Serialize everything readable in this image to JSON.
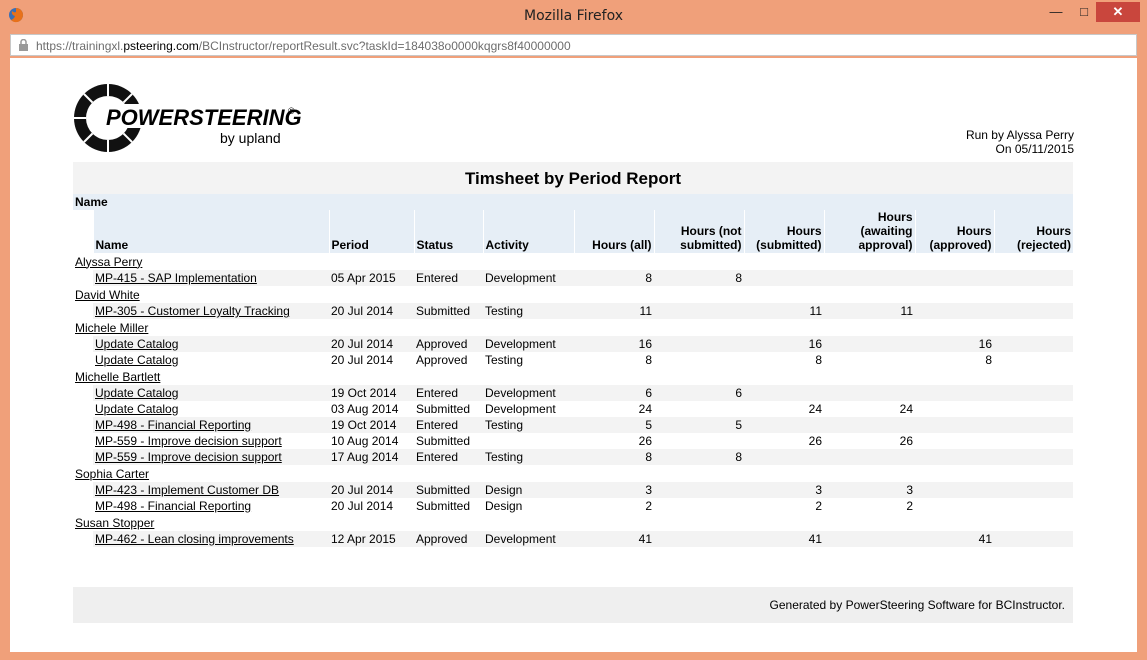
{
  "browser": {
    "window_title": "Mozilla Firefox",
    "url_prefix": "https://trainingxl.",
    "url_host": "psteering.com",
    "url_path": "/BCInstructor/reportResult.svc?taskId=184038o0000kqgrs8f40000000",
    "minimize": "—",
    "maximize": "□",
    "close": "✕"
  },
  "logo": {
    "brand": "POWERSTEERING",
    "sub": "by upland",
    "reg": "®"
  },
  "run_info": {
    "run_by": "Run by Alyssa Perry",
    "on_date": "On 05/11/2015"
  },
  "report_title": "Timsheet by Period Report",
  "group_header": "Name",
  "columns": [
    "Name",
    "Period",
    "Status",
    "Activity",
    "Hours (all)",
    "Hours (not submitted)",
    "Hours (submitted)",
    "Hours (awaiting approval)",
    "Hours (approved)",
    "Hours (rejected)"
  ],
  "rows": [
    {
      "person": "Alyssa Perry"
    },
    {
      "name": "MP-415 - SAP Implementation",
      "period": "05 Apr 2015",
      "status": "Entered",
      "activity": "Development",
      "all": "8",
      "not_sub": "8",
      "sub": "",
      "await": "",
      "appr": "",
      "rej": ""
    },
    {
      "person": "David White"
    },
    {
      "name": "MP-305 - Customer Loyalty Tracking",
      "period": "20 Jul 2014",
      "status": "Submitted",
      "activity": "Testing",
      "all": "11",
      "not_sub": "",
      "sub": "11",
      "await": "11",
      "appr": "",
      "rej": ""
    },
    {
      "person": "Michele Miller"
    },
    {
      "name": "Update Catalog",
      "period": "20 Jul 2014",
      "status": "Approved",
      "activity": "Development",
      "all": "16",
      "not_sub": "",
      "sub": "16",
      "await": "",
      "appr": "16",
      "rej": ""
    },
    {
      "name": "Update Catalog",
      "period": "20 Jul 2014",
      "status": "Approved",
      "activity": "Testing",
      "all": "8",
      "not_sub": "",
      "sub": "8",
      "await": "",
      "appr": "8",
      "rej": ""
    },
    {
      "person": "Michelle Bartlett"
    },
    {
      "name": "Update Catalog",
      "period": "19 Oct 2014",
      "status": "Entered",
      "activity": "Development",
      "all": "6",
      "not_sub": "6",
      "sub": "",
      "await": "",
      "appr": "",
      "rej": ""
    },
    {
      "name": "Update Catalog",
      "period": "03 Aug 2014",
      "status": "Submitted",
      "activity": "Development",
      "all": "24",
      "not_sub": "",
      "sub": "24",
      "await": "24",
      "appr": "",
      "rej": ""
    },
    {
      "name": "MP-498 - Financial Reporting",
      "period": "19 Oct 2014",
      "status": "Entered",
      "activity": "Testing",
      "all": "5",
      "not_sub": "5",
      "sub": "",
      "await": "",
      "appr": "",
      "rej": ""
    },
    {
      "name": "MP-559 - Improve decision support",
      "period": "10 Aug 2014",
      "status": "Submitted",
      "activity": "",
      "all": "26",
      "not_sub": "",
      "sub": "26",
      "await": "26",
      "appr": "",
      "rej": ""
    },
    {
      "name": "MP-559 - Improve decision support",
      "period": "17 Aug 2014",
      "status": "Entered",
      "activity": "Testing",
      "all": "8",
      "not_sub": "8",
      "sub": "",
      "await": "",
      "appr": "",
      "rej": ""
    },
    {
      "person": "Sophia Carter"
    },
    {
      "name": "MP-423 - Implement Customer DB",
      "period": "20 Jul 2014",
      "status": "Submitted",
      "activity": "Design",
      "all": "3",
      "not_sub": "",
      "sub": "3",
      "await": "3",
      "appr": "",
      "rej": ""
    },
    {
      "name": "MP-498 - Financial Reporting",
      "period": "20 Jul 2014",
      "status": "Submitted",
      "activity": "Design",
      "all": "2",
      "not_sub": "",
      "sub": "2",
      "await": "2",
      "appr": "",
      "rej": ""
    },
    {
      "person": "Susan Stopper"
    },
    {
      "name": "MP-462 - Lean closing improvements",
      "period": "12 Apr 2015",
      "status": "Approved",
      "activity": "Development",
      "all": "41",
      "not_sub": "",
      "sub": "41",
      "await": "",
      "appr": "41",
      "rej": ""
    }
  ],
  "footer": "Generated by PowerSteering Software for BCInstructor."
}
